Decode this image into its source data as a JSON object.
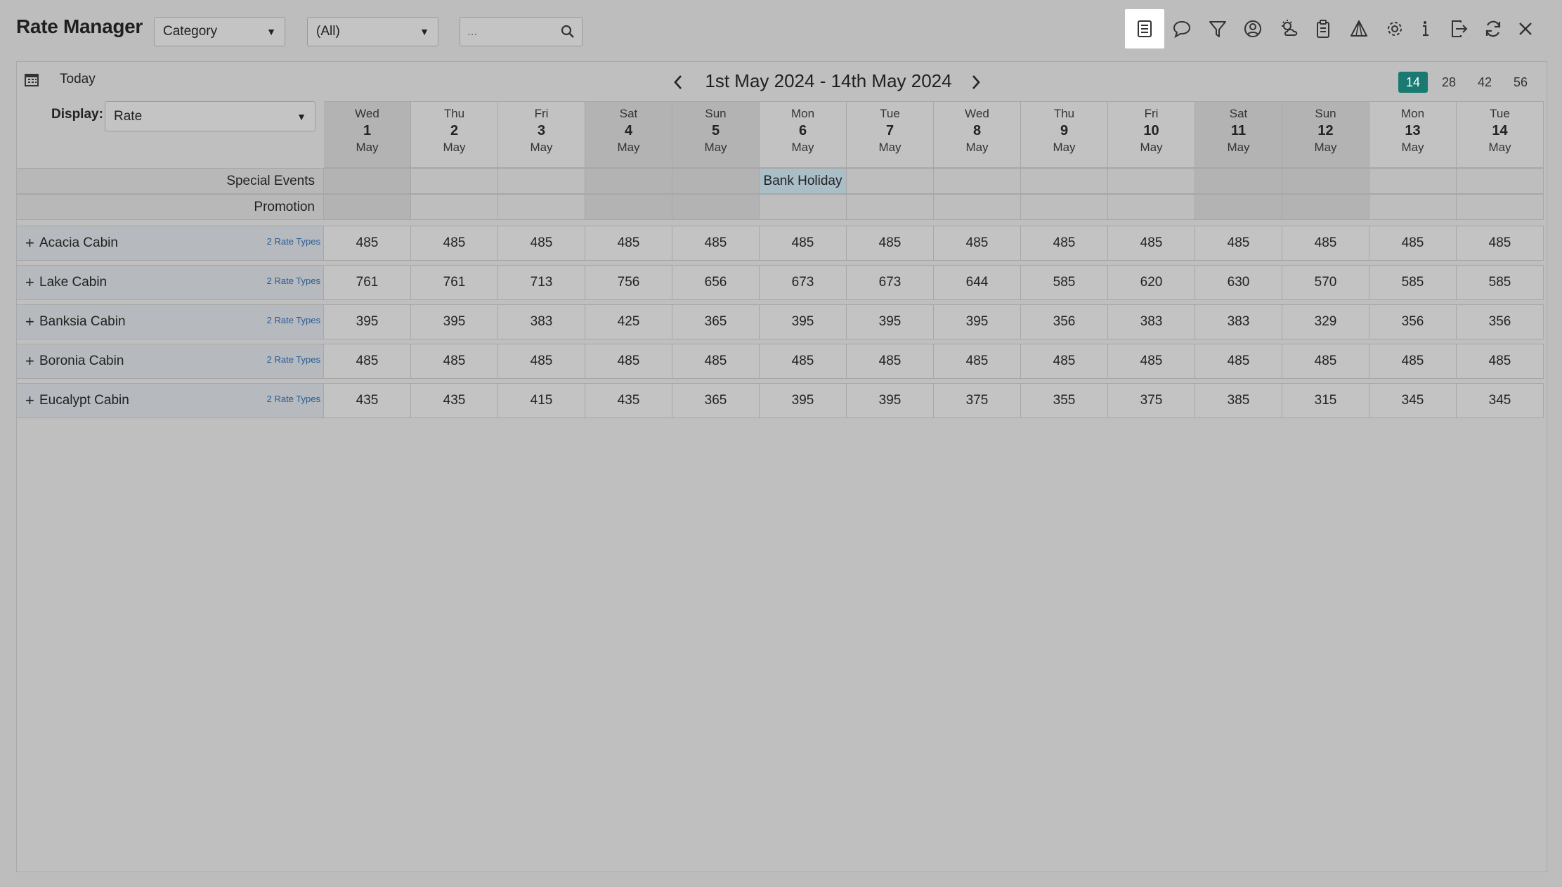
{
  "app": {
    "title": "Rate Manager"
  },
  "filters": {
    "category_select": "Category",
    "all_select": "(All)",
    "search_placeholder": "..."
  },
  "toolbar_icons": [
    "list-icon",
    "comment-icon",
    "filter-icon",
    "user-circle-icon",
    "weather-icon",
    "clipboard-icon",
    "triangle-chart-icon",
    "gear-icon",
    "info-icon",
    "exit-icon",
    "refresh-icon",
    "close-icon"
  ],
  "panel": {
    "today_label": "Today",
    "date_range": "1st May 2024 - 14th May 2024",
    "spans": [
      "14",
      "28",
      "42",
      "56"
    ],
    "active_span": "14",
    "display_label": "Display:",
    "display_value": "Rate"
  },
  "days": [
    {
      "dow": "Wed",
      "dom": "1",
      "mon": "May"
    },
    {
      "dow": "Thu",
      "dom": "2",
      "mon": "May"
    },
    {
      "dow": "Fri",
      "dom": "3",
      "mon": "May"
    },
    {
      "dow": "Sat",
      "dom": "4",
      "mon": "May"
    },
    {
      "dow": "Sun",
      "dom": "5",
      "mon": "May"
    },
    {
      "dow": "Mon",
      "dom": "6",
      "mon": "May"
    },
    {
      "dow": "Tue",
      "dom": "7",
      "mon": "May"
    },
    {
      "dow": "Wed",
      "dom": "8",
      "mon": "May"
    },
    {
      "dow": "Thu",
      "dom": "9",
      "mon": "May"
    },
    {
      "dow": "Fri",
      "dom": "10",
      "mon": "May"
    },
    {
      "dow": "Sat",
      "dom": "11",
      "mon": "May"
    },
    {
      "dow": "Sun",
      "dom": "12",
      "mon": "May"
    },
    {
      "dow": "Mon",
      "dom": "13",
      "mon": "May"
    },
    {
      "dow": "Tue",
      "dom": "14",
      "mon": "May"
    }
  ],
  "special_events": {
    "label": "Special Events",
    "events": [
      "",
      "",
      "",
      "",
      "",
      "Bank Holiday",
      "",
      "",
      "",
      "",
      "",
      "",
      "",
      ""
    ]
  },
  "promotion": {
    "label": "Promotion"
  },
  "categories": [
    {
      "name": "Acacia Cabin",
      "rate_types": "2 Rate Types",
      "rates": [
        "485",
        "485",
        "485",
        "485",
        "485",
        "485",
        "485",
        "485",
        "485",
        "485",
        "485",
        "485",
        "485",
        "485"
      ]
    },
    {
      "name": "Lake Cabin",
      "rate_types": "2 Rate Types",
      "rates": [
        "761",
        "761",
        "713",
        "756",
        "656",
        "673",
        "673",
        "644",
        "585",
        "620",
        "630",
        "570",
        "585",
        "585"
      ]
    },
    {
      "name": "Banksia Cabin",
      "rate_types": "2 Rate Types",
      "rates": [
        "395",
        "395",
        "383",
        "425",
        "365",
        "395",
        "395",
        "395",
        "356",
        "383",
        "383",
        "329",
        "356",
        "356"
      ]
    },
    {
      "name": "Boronia Cabin",
      "rate_types": "2 Rate Types",
      "rates": [
        "485",
        "485",
        "485",
        "485",
        "485",
        "485",
        "485",
        "485",
        "485",
        "485",
        "485",
        "485",
        "485",
        "485"
      ]
    },
    {
      "name": "Eucalypt Cabin",
      "rate_types": "2 Rate Types",
      "rates": [
        "435",
        "435",
        "415",
        "435",
        "365",
        "395",
        "395",
        "375",
        "355",
        "375",
        "385",
        "315",
        "345",
        "345"
      ]
    }
  ]
}
